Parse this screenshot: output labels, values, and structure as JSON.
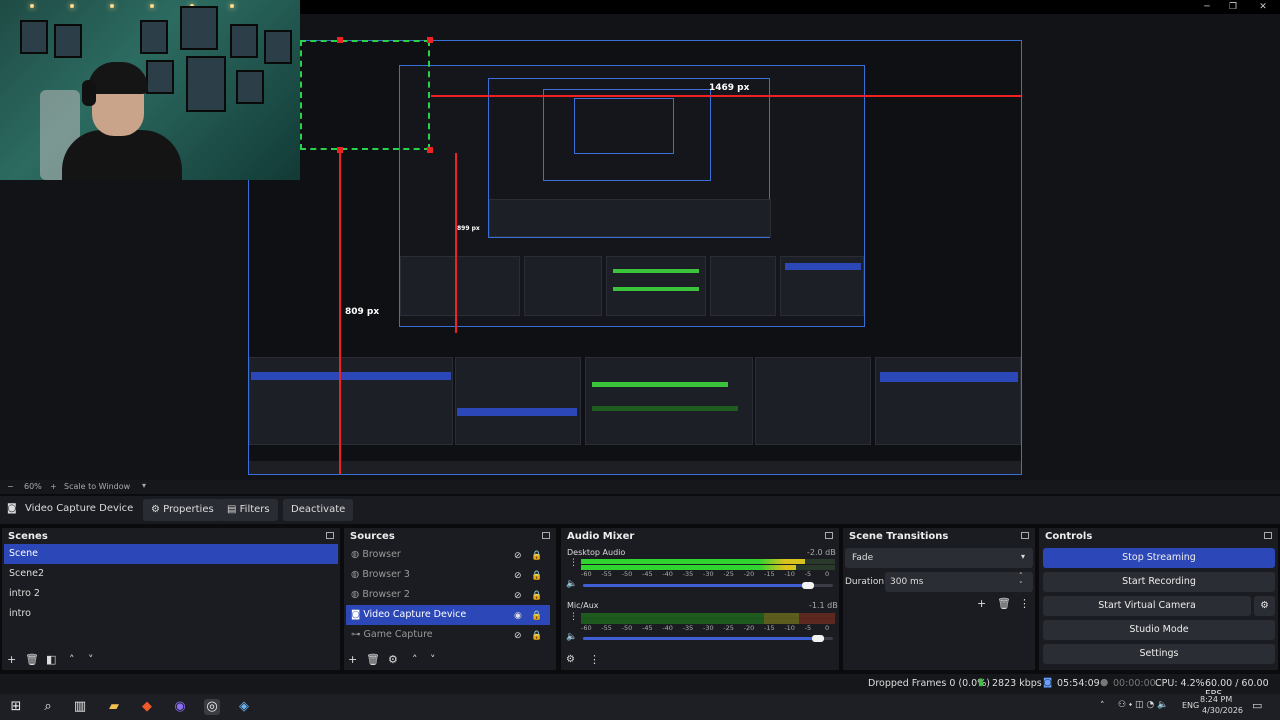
{
  "window": {
    "minimize": "─",
    "maximize": "❐",
    "close": "✕"
  },
  "preview": {
    "measure_horizontal": "1469 px",
    "measure_vertical": "809 px",
    "measure_inner": "899 px"
  },
  "zoombar": {
    "minus": "−",
    "zoom": "60%",
    "plus": "+",
    "scale_mode": "Scale to Window"
  },
  "source_toolbar": {
    "source_name": "Video Capture Device",
    "properties": "Properties",
    "filters": "Filters",
    "deactivate": "Deactivate"
  },
  "scenes": {
    "title": "Scenes",
    "items": [
      "Scene",
      "Scene2",
      "intro 2",
      "intro"
    ],
    "selected": "Scene"
  },
  "sources": {
    "title": "Sources",
    "items": [
      {
        "label": "Browser",
        "icon": "globe-icon"
      },
      {
        "label": "Browser 3",
        "icon": "globe-icon"
      },
      {
        "label": "Browser 2",
        "icon": "globe-icon"
      },
      {
        "label": "Video Capture Device",
        "icon": "camera-icon"
      },
      {
        "label": "Game Capture",
        "icon": "gamepad-icon"
      }
    ],
    "selected": "Video Capture Device"
  },
  "audio_mixer": {
    "title": "Audio Mixer",
    "channels": [
      {
        "name": "Desktop Audio",
        "db": "-2.0 dB",
        "level": 0.88,
        "volume": 0.9
      },
      {
        "name": "Mic/Aux",
        "db": "-1.1 dB",
        "level": 0.0,
        "volume": 0.94
      }
    ],
    "scale": [
      "-60",
      "-55",
      "-50",
      "-45",
      "-40",
      "-35",
      "-30",
      "-25",
      "-20",
      "-15",
      "-10",
      "-5",
      "0"
    ]
  },
  "scene_transitions": {
    "title": "Scene Transitions",
    "transition": "Fade",
    "duration_label": "Duration",
    "duration": "300 ms"
  },
  "controls": {
    "title": "Controls",
    "stop_streaming": "Stop Streaming",
    "start_recording": "Start Recording",
    "start_virtual_camera": "Start Virtual Camera",
    "studio_mode": "Studio Mode",
    "settings": "Settings"
  },
  "status": {
    "dropped_frames": "Dropped Frames 0 (0.0%)",
    "bitrate": "2823 kbps",
    "stream_time": "05:54:09",
    "record_time": "00:00:00",
    "cpu": "CPU: 4.2%",
    "fps": "60.00 / 60.00 FPS"
  },
  "taskbar": {
    "lang": "ENG",
    "time": "8:24 PM",
    "date": "4/30/2026"
  },
  "colors": {
    "accent": "#2c47b8",
    "canvas_border": "#3a6fd8",
    "guide": "#ee2222",
    "selection": "#2ad24a"
  }
}
